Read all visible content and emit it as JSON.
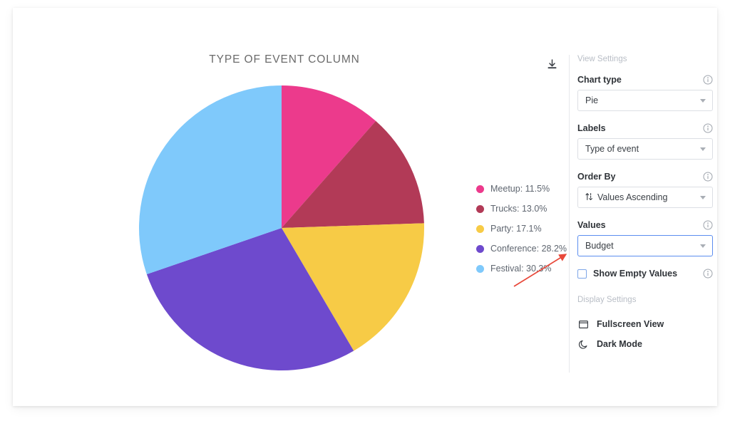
{
  "chart_data": {
    "type": "pie",
    "title": "TYPE OF EVENT COLUMN",
    "labels": [
      "Meetup",
      "Trucks",
      "Party",
      "Conference",
      "Festival"
    ],
    "values": [
      11.5,
      13.0,
      17.1,
      28.2,
      30.3
    ],
    "unit": "%",
    "colors": [
      "#ec3a8c",
      "#b23a57",
      "#f7cb46",
      "#6e4acd",
      "#7fc9fb"
    ],
    "legend_position": "right",
    "legend_entries": [
      "Meetup: 11.5%",
      "Trucks: 13.0%",
      "Party: 17.1%",
      "Conference: 28.2%",
      "Festival: 30.3%"
    ],
    "start_angle": 0,
    "direction": "clockwise",
    "grid": false,
    "xlabel": "",
    "ylabel": ""
  },
  "toolbar": {
    "download_icon": "download-icon"
  },
  "panel": {
    "view_settings_heading": "View Settings",
    "fields": [
      {
        "label": "Chart type",
        "value": "Pie",
        "icon": "",
        "focused": false
      },
      {
        "label": "Labels",
        "value": "Type of event",
        "icon": "",
        "focused": false
      },
      {
        "label": "Order By",
        "value": "Values Ascending",
        "icon": "sort-icon",
        "focused": false
      },
      {
        "label": "Values",
        "value": "Budget",
        "icon": "",
        "focused": true
      }
    ],
    "checkbox": {
      "label": "Show Empty Values",
      "checked": false
    },
    "display_settings_heading": "Display Settings",
    "display_options": [
      {
        "label": "Fullscreen View",
        "icon": "fullscreen-icon"
      },
      {
        "label": "Dark Mode",
        "icon": "moon-icon"
      }
    ],
    "info_icon": "info-icon",
    "focus_color": "#5b8def"
  },
  "annotation": {
    "color": "#e8483a",
    "type": "arrow",
    "points_to": "Values"
  }
}
